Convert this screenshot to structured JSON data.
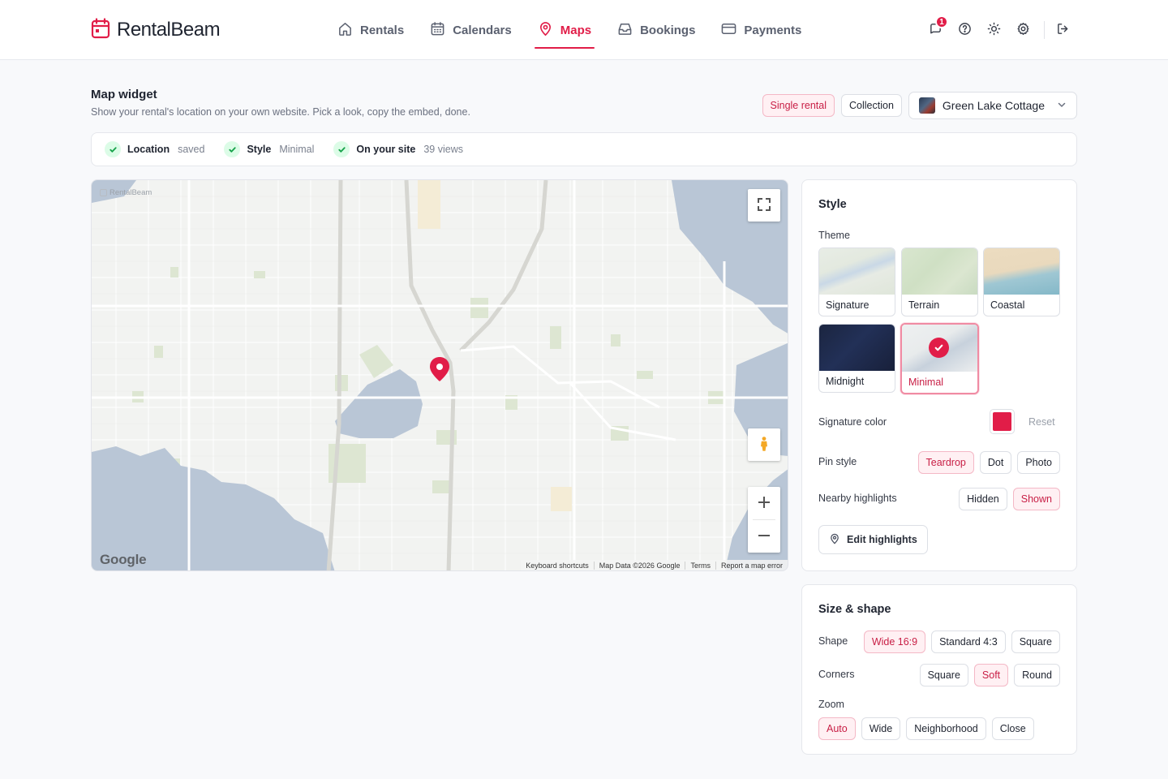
{
  "brand": {
    "name": "RentalBeam"
  },
  "nav": [
    {
      "label": "Rentals",
      "icon": "home-icon"
    },
    {
      "label": "Calendars",
      "icon": "calendar-icon"
    },
    {
      "label": "Maps",
      "icon": "map-pin-icon",
      "active": true
    },
    {
      "label": "Bookings",
      "icon": "inbox-icon"
    },
    {
      "label": "Payments",
      "icon": "credit-card-icon"
    }
  ],
  "header": {
    "notification_count": "1"
  },
  "page": {
    "title": "Map widget",
    "subtitle": "Show your rental's location on your own website. Pick a look, copy the embed, done.",
    "scope_single": "Single rental",
    "scope_collection": "Collection",
    "selected_rental": "Green Lake Cottage"
  },
  "status": [
    {
      "label": "Location",
      "value": "saved"
    },
    {
      "label": "Style",
      "value": "Minimal"
    },
    {
      "label": "On your site",
      "value": "39 views"
    }
  ],
  "map": {
    "watermark": "RentalBeam",
    "provider_logo": "Google",
    "attribution": [
      "Keyboard shortcuts",
      "Map Data ©2026 Google",
      "Terms",
      "Report a map error"
    ]
  },
  "style_panel": {
    "title": "Style",
    "theme_label": "Theme",
    "themes": [
      {
        "name": "Signature"
      },
      {
        "name": "Terrain"
      },
      {
        "name": "Coastal"
      },
      {
        "name": "Midnight"
      },
      {
        "name": "Minimal",
        "selected": true
      }
    ],
    "signature_color_label": "Signature color",
    "signature_color": "#e11d48",
    "reset_label": "Reset",
    "pin_style_label": "Pin style",
    "pin_styles": [
      "Teardrop",
      "Dot",
      "Photo"
    ],
    "pin_style_selected": "Teardrop",
    "nearby_label": "Nearby highlights",
    "nearby_options": [
      "Hidden",
      "Shown"
    ],
    "nearby_selected": "Shown",
    "edit_highlights_label": "Edit highlights"
  },
  "size_panel": {
    "title": "Size & shape",
    "shape_label": "Shape",
    "shapes": [
      "Wide 16:9",
      "Standard 4:3",
      "Square"
    ],
    "shape_selected": "Wide 16:9",
    "corners_label": "Corners",
    "corners": [
      "Square",
      "Soft",
      "Round"
    ],
    "corners_selected": "Soft",
    "zoom_label": "Zoom",
    "zooms": [
      "Auto",
      "Wide",
      "Neighborhood",
      "Close"
    ],
    "zoom_selected": "Auto"
  },
  "colors": {
    "accent": "#e11d48",
    "water": "#b9c6d6",
    "park": "#dde6d2"
  }
}
